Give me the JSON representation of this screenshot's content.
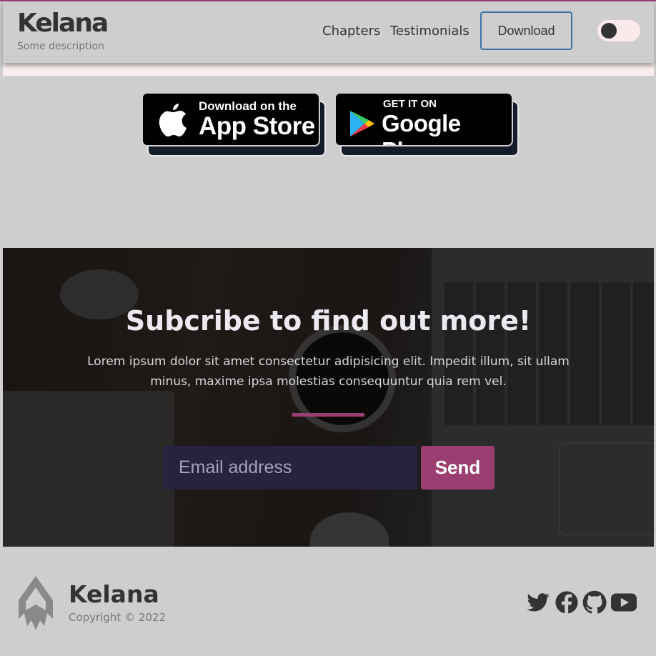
{
  "header": {
    "brand_title": "Kelana",
    "brand_description": "Some description",
    "nav": [
      {
        "label": "Chapters"
      },
      {
        "label": "Testimonials"
      }
    ],
    "download_label": "Download",
    "theme_toggle_icon": "toggle-switch-icon"
  },
  "badges": {
    "apple": {
      "small": "Download on the",
      "big": "App Store",
      "icon": "apple-logo-icon"
    },
    "google": {
      "small": "GET IT ON",
      "big": "Google Play",
      "icon": "google-play-logo-icon"
    }
  },
  "subscribe": {
    "title": "Subcribe to find out more!",
    "text": "Lorem ipsum dolor sit amet consectetur adipisicing elit. Impedit illum, sit ullam minus, maxime ipsa molestias consequuntur quia rem vel.",
    "email_placeholder": "Email address",
    "email_value": "",
    "send_label": "Send"
  },
  "footer": {
    "brand": "Kelana",
    "copyright": "Copyright © 2022",
    "socials": [
      "twitter-icon",
      "facebook-icon",
      "github-icon",
      "youtube-icon"
    ]
  },
  "colors": {
    "accent": "#9b3f72",
    "download_border": "#3d74a6",
    "page_bg": "#cecece",
    "input_bg": "#262240"
  }
}
